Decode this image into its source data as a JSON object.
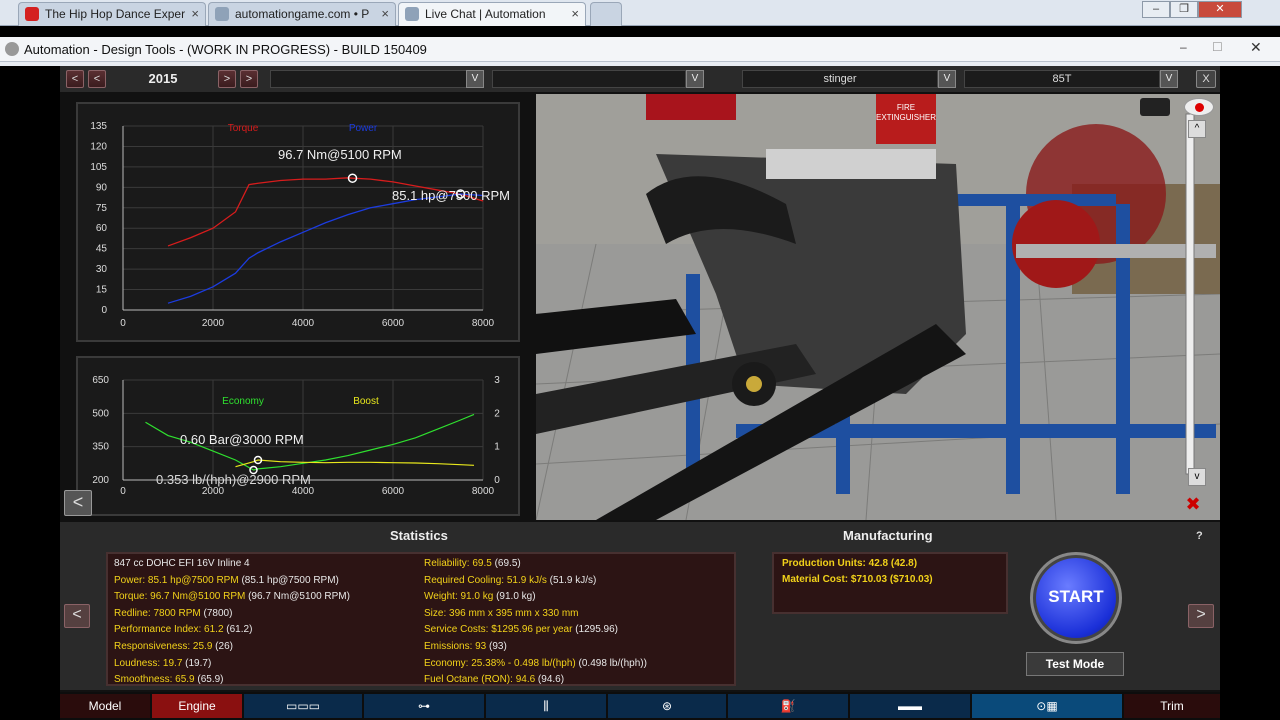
{
  "browser": {
    "tabs": [
      {
        "label": "The Hip Hop Dance Exper",
        "icon": "youtube-icon"
      },
      {
        "label": "automationgame.com • P",
        "icon": "page-icon"
      },
      {
        "label": "Live Chat | Automation",
        "icon": "page-icon"
      }
    ],
    "window_title": "Automation - Design Tools - (WORK IN PROGRESS) - BUILD 150409"
  },
  "toolbar": {
    "year": "2015",
    "model_name": "stinger",
    "trim_name": "85T",
    "close_label": "X"
  },
  "power_chart": {
    "y_ticks": [
      "135",
      "120",
      "105",
      "90",
      "75",
      "60",
      "45",
      "30",
      "15",
      "0"
    ],
    "x_ticks": [
      "0",
      "2000",
      "4000",
      "6000",
      "8000"
    ],
    "legend_torque": "Torque",
    "legend_power": "Power",
    "annot_torque": "96.7 Nm@5100 RPM",
    "annot_power": "85.1 hp@7500 RPM",
    "colors": {
      "torque": "#d81c1c",
      "power": "#1c3ce0"
    }
  },
  "econ_chart": {
    "y_ticks_left": [
      "650",
      "500",
      "350",
      "200"
    ],
    "y_ticks_right": [
      "3",
      "2",
      "1",
      "0"
    ],
    "x_ticks": [
      "0",
      "2000",
      "4000",
      "6000",
      "8000"
    ],
    "legend_economy": "Economy",
    "legend_boost": "Boost",
    "annot_boost": "0.60 Bar@3000 RPM",
    "annot_econ": "0.353 lb/(hph)@2900 RPM",
    "colors": {
      "economy": "#2fe02f",
      "boost": "#e8e81c"
    }
  },
  "chart_data": [
    {
      "type": "line",
      "x": [
        1000,
        1500,
        2000,
        2500,
        2800,
        3000,
        3500,
        4000,
        4500,
        5000,
        5100,
        5500,
        6000,
        6500,
        7000,
        7500,
        8000
      ],
      "series": [
        {
          "name": "Torque",
          "values": [
            47,
            53,
            60,
            72,
            92,
            93,
            95,
            96,
            96,
            97,
            96.7,
            96,
            94,
            91,
            88,
            85,
            80
          ]
        },
        {
          "name": "Power",
          "values": [
            5,
            10,
            17,
            27,
            38,
            42,
            50,
            57,
            64,
            70,
            71,
            75,
            78,
            81,
            83,
            85.1,
            84
          ]
        }
      ],
      "xlim": [
        0,
        8000
      ],
      "ylim": [
        0,
        135
      ]
    },
    {
      "type": "line",
      "x": [
        500,
        1000,
        1500,
        2000,
        2500,
        2900,
        3000,
        3500,
        4000,
        4500,
        5000,
        5500,
        6000,
        6500,
        7000,
        7500,
        7800
      ],
      "series": [
        {
          "name": "Economy",
          "values": [
            460,
            400,
            370,
            330,
            290,
            245,
            250,
            260,
            275,
            290,
            310,
            335,
            360,
            390,
            430,
            470,
            495
          ]
        },
        {
          "name": "Boost",
          "values": [
            null,
            null,
            null,
            null,
            0.4,
            0.55,
            0.6,
            0.55,
            0.53,
            0.52,
            0.53,
            0.53,
            0.52,
            0.51,
            0.49,
            0.46,
            0.44
          ]
        }
      ],
      "xlim": [
        0,
        8000
      ],
      "ylim_left": [
        200,
        650
      ],
      "ylim_right": [
        0,
        3
      ]
    }
  ],
  "statistics": {
    "title": "Statistics",
    "left": [
      {
        "label": "847 cc DOHC EFI 16V Inline 4",
        "paren": ""
      },
      {
        "label": "Power: 85.1 hp@7500 RPM",
        "paren": "(85.1 hp@7500 RPM)"
      },
      {
        "label": "Torque: 96.7 Nm@5100 RPM",
        "paren": "(96.7 Nm@5100 RPM)"
      },
      {
        "label": "Redline: 7800 RPM",
        "paren": "(7800)"
      },
      {
        "label": "Performance Index: 61.2",
        "paren": "(61.2)"
      },
      {
        "label": "Responsiveness: 25.9",
        "paren": "(26)"
      },
      {
        "label": "Loudness: 19.7",
        "paren": "(19.7)"
      },
      {
        "label": "Smoothness: 65.9",
        "paren": "(65.9)"
      }
    ],
    "right": [
      {
        "label": "Reliability: 69.5",
        "paren": "(69.5)"
      },
      {
        "label": "Required Cooling: 51.9 kJ/s",
        "paren": "(51.9 kJ/s)"
      },
      {
        "label": "Weight: 91.0 kg",
        "paren": "(91.0 kg)"
      },
      {
        "label": "Size: 396 mm x 395 mm x 330 mm",
        "paren": ""
      },
      {
        "label": "Service Costs: $1295.96 per year",
        "paren": "(1295.96)"
      },
      {
        "label": "Emissions: 93",
        "paren": "(93)"
      },
      {
        "label": "Economy: 25.38% - 0.498 lb/(hph)",
        "paren": "(0.498 lb/(hph))"
      },
      {
        "label": "Fuel Octane (RON): 94.6",
        "paren": "(94.6)"
      }
    ]
  },
  "manufacturing": {
    "title": "Manufacturing",
    "production_units": "Production Units: 42.8 (42.8)",
    "material_cost": "Material Cost: $710.03 ($710.03)"
  },
  "actions": {
    "start": "START",
    "test_mode": "Test Mode",
    "help": "?"
  },
  "nav": {
    "model": "Model",
    "engine": "Engine",
    "trim": "Trim"
  }
}
